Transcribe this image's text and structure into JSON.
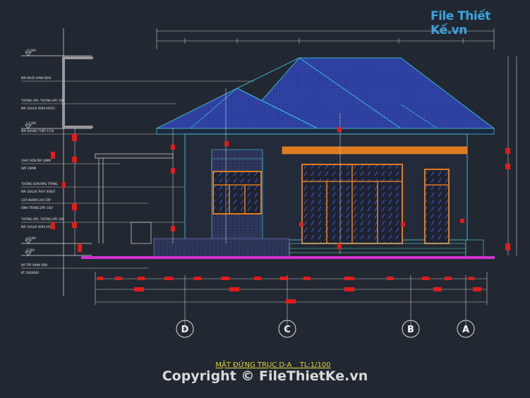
{
  "logo": {
    "text": "File Thiết Kế",
    "suffix": ".vn",
    "color": "#39a5e0"
  },
  "title": "MẶT ĐỨNG TRỤC D-A _ TL:1/100",
  "copyright": "Copyright © FileThietKe.vn",
  "levels": {
    "top": "+5.900",
    "mid": "+3.300",
    "base": "±0.000",
    "ground": "-0.500"
  },
  "annotations": [
    "MÁI NGÓI XANH ĐEN",
    "TƯỜNG XÂY, TƯỜNG XÂY 100",
    "MÃ: DULUX 0099 45015",
    "MÁI KHUNG THÉP 1150",
    "CHẠY RON ÂM 10MM",
    "DÀY 20MM",
    "TƯỜNG SƠN MÀU TRẮNG",
    "MÃ: DULUX 7HVY 00007",
    "CỬA NHÔM CAO CẤP",
    "KÍNH TRONG DÀY 10LY",
    "TƯỜNG XÂY, TƯỜNG XÂY 100",
    "MÃ: DULUX 0099 45015",
    "ĐÁ TẦY XANH ĐEN",
    "KT: 300X600"
  ],
  "axes": [
    "D",
    "C",
    "B",
    "A"
  ],
  "colors": {
    "background": "#222831",
    "roof": "#2c3a9a",
    "frame": "#e07a20",
    "ground": "#d230d2",
    "dim": "#c9c9c9",
    "mark": "#e31b1b"
  }
}
